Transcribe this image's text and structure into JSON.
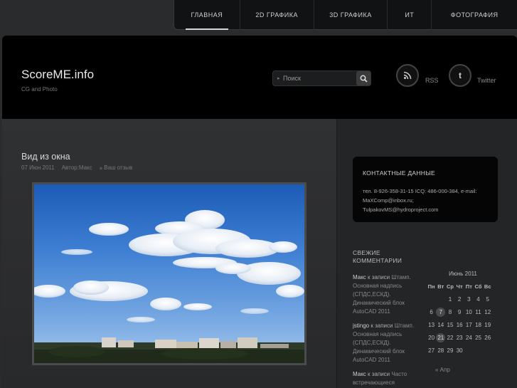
{
  "nav": {
    "items": [
      {
        "label": "ГЛАВНАЯ",
        "width": 93
      },
      {
        "label": "2D ГРАФИКА",
        "width": 104
      },
      {
        "label": "3D ГРАФИКА",
        "width": 104
      },
      {
        "label": "ИТ",
        "width": 62
      },
      {
        "label": "ФОТОГРАФИЯ",
        "width": 120
      }
    ]
  },
  "header": {
    "title": "ScoreME.info",
    "subtitle": "CG and Photo",
    "search_placeholder": "Поиск",
    "rss_label": "RSS",
    "twitter_label": "Twitter"
  },
  "post": {
    "title": "Вид из окна",
    "date": "07 Июн 2011",
    "author": "Автор:Макс",
    "feedback": "Ваш отзыв"
  },
  "sidebar": {
    "contact_title": "КОНТАКТНЫЕ ДАННЫЕ",
    "contact_text": "тел. 8-926-358-31-15 ICQ: 486-000-384, e-mail: MaXComp@inbox.ru; TulpakovMS@hydroproject.com",
    "comments_title": "СВЕЖИЕ КОММЕНТАРИИ",
    "comments": [
      {
        "who": "Макс",
        "mid": " к записи ",
        "text": "Штамп. Основная надпись (СПДС,ЕСКД). Динамический блок AutoCAD 2011"
      },
      {
        "who": "jstingo",
        "mid": " к записи ",
        "text": "Штамп. Основная надпись (СПДС,ЕСКД). Динамический блок AutoCAD 2011"
      },
      {
        "who": "Макс",
        "mid": " к записи ",
        "text": "Часто встречающиеся проблемы AutoCAD"
      }
    ]
  },
  "calendar": {
    "caption": "Июнь 2011",
    "headers": [
      "Пн",
      "Вт",
      "Ср",
      "Чт",
      "Пт",
      "Сб",
      "Вс"
    ],
    "weeks": [
      [
        "",
        "",
        "1",
        "2",
        "3",
        "4",
        "5"
      ],
      [
        "6",
        "7",
        "8",
        "9",
        "10",
        "11",
        "12"
      ],
      [
        "13",
        "14",
        "15",
        "16",
        "17",
        "18",
        "19"
      ],
      [
        "20",
        "21",
        "22",
        "23",
        "24",
        "25",
        "26"
      ],
      [
        "27",
        "28",
        "29",
        "30",
        "",
        "",
        ""
      ]
    ],
    "marked": [
      "7",
      "21"
    ],
    "prev": "« Апр"
  }
}
